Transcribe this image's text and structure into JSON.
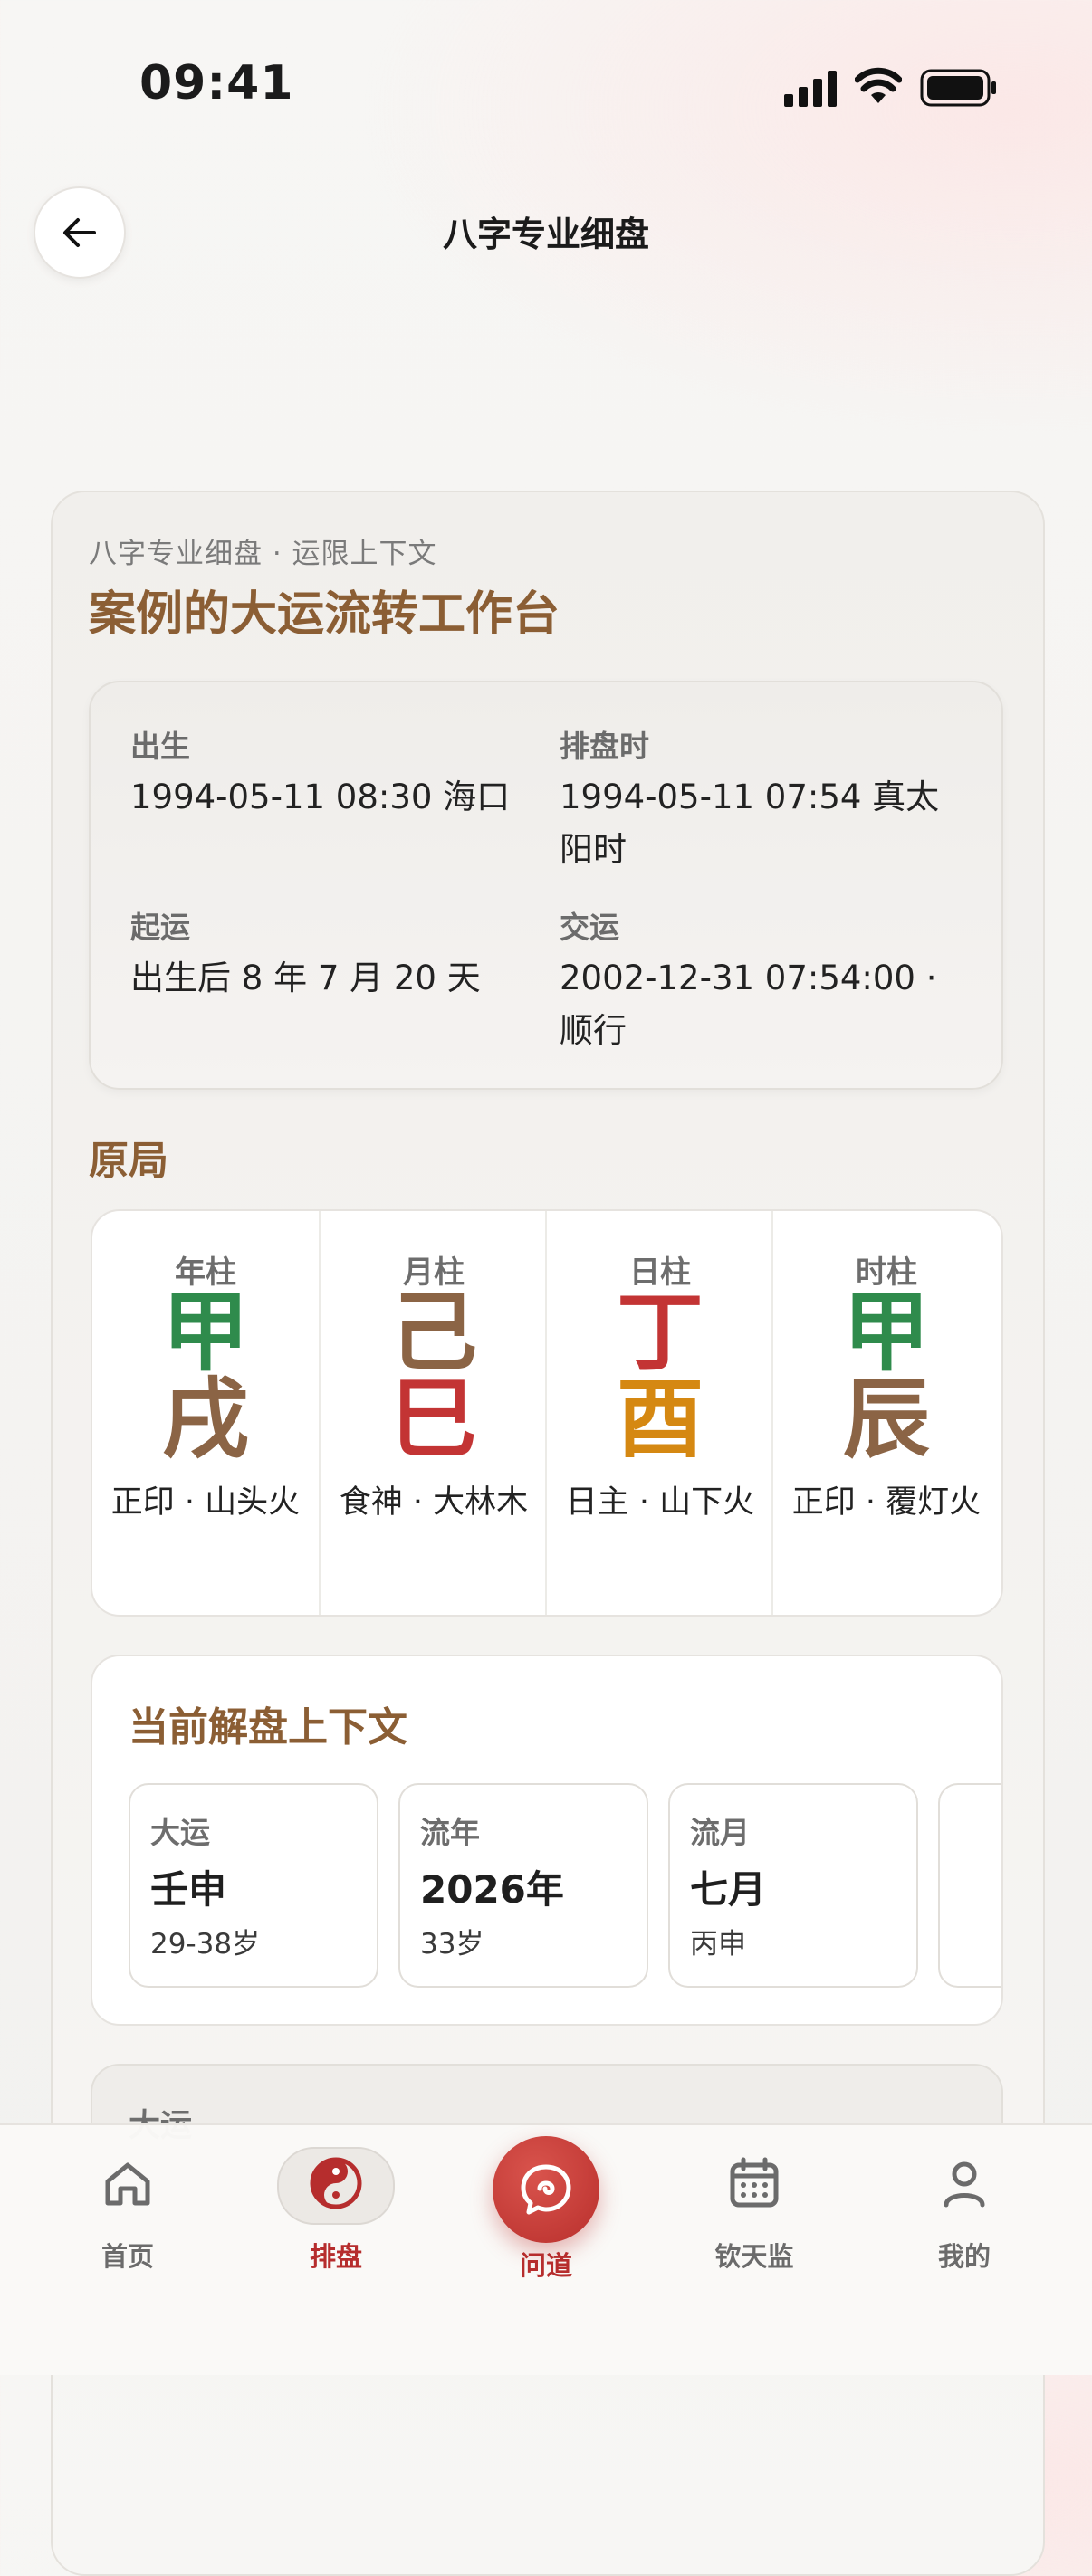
{
  "status": {
    "time": "09:41"
  },
  "header": {
    "title": "八字专业细盘"
  },
  "card": {
    "kicker": "八字专业细盘 · 运限上下文",
    "title": "案例的大运流转工作台",
    "info": {
      "birth_label": "出生",
      "birth_value": "1994-05-11 08:30 海口",
      "chart_time_label": "排盘时",
      "chart_time_value": "1994-05-11 07:54 真太阳时",
      "start_label": "起运",
      "start_value": "出生后 8 年 7 月 20 天",
      "handover_label": "交运",
      "handover_value": "2002-12-31 07:54:00 · 顺行"
    },
    "section_original": "原局",
    "pillars": [
      {
        "label": "年柱",
        "stem": "甲",
        "branch": "戌",
        "desc": "正印 · 山头火"
      },
      {
        "label": "月柱",
        "stem": "己",
        "branch": "巳",
        "desc": "食神 · 大林木"
      },
      {
        "label": "日柱",
        "stem": "丁",
        "branch": "酉",
        "desc": "日主 · 山下火"
      },
      {
        "label": "时柱",
        "stem": "甲",
        "branch": "辰",
        "desc": "正印 · 覆灯火"
      }
    ],
    "context": {
      "title": "当前解盘上下文",
      "chips": [
        {
          "label": "大运",
          "value": "壬申",
          "sub": "29-38岁"
        },
        {
          "label": "流年",
          "value": "2026年",
          "sub": "33岁"
        },
        {
          "label": "流月",
          "value": "七月",
          "sub": "丙申"
        }
      ]
    },
    "peek_label": "大运"
  },
  "tabs": [
    {
      "label": "首页",
      "icon": "home-icon"
    },
    {
      "label": "排盘",
      "icon": "yin-yang-icon",
      "active": true
    },
    {
      "label": "问道",
      "icon": "chat-icon",
      "center": true
    },
    {
      "label": "钦天监",
      "icon": "calendar-icon"
    },
    {
      "label": "我的",
      "icon": "user-icon"
    }
  ],
  "colors": {
    "accent": "#b62d2d",
    "brown_title": "#8b5e34",
    "wood": "#2f8b4c",
    "earth": "#8b6445",
    "fire": "#c33434",
    "metal": "#d58812"
  }
}
